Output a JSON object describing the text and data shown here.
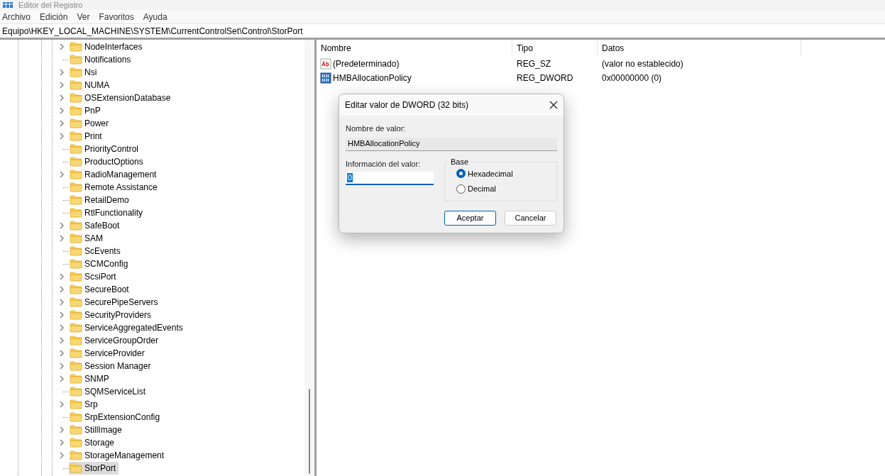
{
  "window": {
    "title": "Editor del Registro"
  },
  "menu": [
    "Archivo",
    "Edición",
    "Ver",
    "Favoritos",
    "Ayuda"
  ],
  "address": "Equipo\\HKEY_LOCAL_MACHINE\\SYSTEM\\CurrentControlSet\\Control\\StorPort",
  "tree": [
    {
      "label": "NodeInterfaces",
      "expandable": true,
      "selected": false
    },
    {
      "label": "Notifications",
      "expandable": false,
      "selected": false
    },
    {
      "label": "Nsi",
      "expandable": true,
      "selected": false
    },
    {
      "label": "NUMA",
      "expandable": true,
      "selected": false
    },
    {
      "label": "OSExtensionDatabase",
      "expandable": true,
      "selected": false
    },
    {
      "label": "PnP",
      "expandable": true,
      "selected": false
    },
    {
      "label": "Power",
      "expandable": true,
      "selected": false
    },
    {
      "label": "Print",
      "expandable": true,
      "selected": false
    },
    {
      "label": "PriorityControl",
      "expandable": false,
      "selected": false
    },
    {
      "label": "ProductOptions",
      "expandable": false,
      "selected": false
    },
    {
      "label": "RadioManagement",
      "expandable": true,
      "selected": false
    },
    {
      "label": "Remote Assistance",
      "expandable": false,
      "selected": false
    },
    {
      "label": "RetailDemo",
      "expandable": false,
      "selected": false
    },
    {
      "label": "RtlFunctionality",
      "expandable": false,
      "selected": false
    },
    {
      "label": "SafeBoot",
      "expandable": true,
      "selected": false
    },
    {
      "label": "SAM",
      "expandable": true,
      "selected": false
    },
    {
      "label": "ScEvents",
      "expandable": false,
      "selected": false
    },
    {
      "label": "SCMConfig",
      "expandable": false,
      "selected": false
    },
    {
      "label": "ScsiPort",
      "expandable": true,
      "selected": false
    },
    {
      "label": "SecureBoot",
      "expandable": true,
      "selected": false
    },
    {
      "label": "SecurePipeServers",
      "expandable": true,
      "selected": false
    },
    {
      "label": "SecurityProviders",
      "expandable": true,
      "selected": false
    },
    {
      "label": "ServiceAggregatedEvents",
      "expandable": true,
      "selected": false
    },
    {
      "label": "ServiceGroupOrder",
      "expandable": true,
      "selected": false
    },
    {
      "label": "ServiceProvider",
      "expandable": true,
      "selected": false
    },
    {
      "label": "Session Manager",
      "expandable": true,
      "selected": false
    },
    {
      "label": "SNMP",
      "expandable": true,
      "selected": false
    },
    {
      "label": "SQMServiceList",
      "expandable": false,
      "selected": false
    },
    {
      "label": "Srp",
      "expandable": true,
      "selected": false
    },
    {
      "label": "SrpExtensionConfig",
      "expandable": false,
      "selected": false
    },
    {
      "label": "StillImage",
      "expandable": true,
      "selected": false
    },
    {
      "label": "Storage",
      "expandable": true,
      "selected": false
    },
    {
      "label": "StorageManagement",
      "expandable": true,
      "selected": false
    },
    {
      "label": "StorPort",
      "expandable": false,
      "selected": true
    }
  ],
  "values": {
    "columns": [
      "Nombre",
      "Tipo",
      "Datos"
    ],
    "rows": [
      {
        "kind": "string",
        "name": "(Predeterminado)",
        "type": "REG_SZ",
        "data": "(valor no establecido)"
      },
      {
        "kind": "binary",
        "name": "HMBAllocationPolicy",
        "type": "REG_DWORD",
        "data": "0x00000000 (0)"
      }
    ]
  },
  "dialog": {
    "title": "Editar valor de DWORD (32 bits)",
    "name_label": "Nombre de valor:",
    "name_value": "HMBAllocationPolicy",
    "data_label": "Información del valor:",
    "data_value": "0",
    "base_label": "Base",
    "base_options": [
      {
        "label": "Hexadecimal",
        "selected": true
      },
      {
        "label": "Decimal",
        "selected": false
      }
    ],
    "buttons": [
      {
        "label": "Aceptar",
        "default": true
      },
      {
        "label": "Cancelar",
        "default": false
      }
    ]
  }
}
